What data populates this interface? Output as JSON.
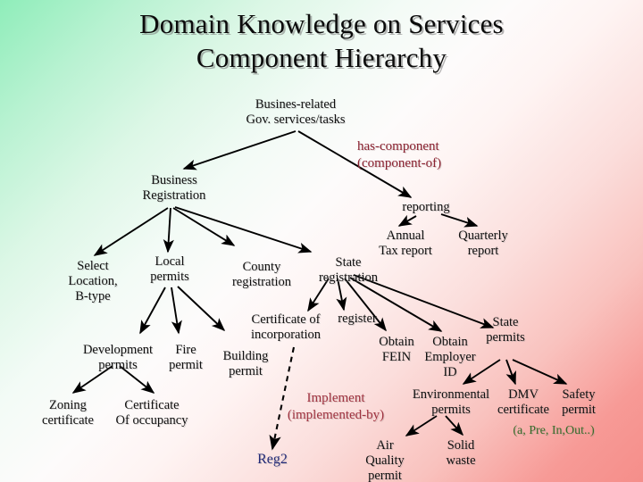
{
  "slide": {
    "title": "Domain Knowledge on Services\nComponent Hierarchy",
    "background": {
      "from": "#8FEDBA",
      "mid": "#FDFBFB",
      "to": "#F58E8A"
    }
  },
  "legends": [
    {
      "key": "has_component",
      "text": "has-component\n(component-of)",
      "color": "#8B2231",
      "meaning": "solid-arrow-relation"
    },
    {
      "key": "implement",
      "text": "Implement\n(implemented-by)",
      "color": "#A03340",
      "meaning": "dashed-arrow-relation"
    }
  ],
  "nodes": {
    "root": "Busines-related\nGov. services/tasks",
    "business_registration": "Business\nRegistration",
    "reporting": "reporting",
    "annual_tax_report": "Annual\nTax report",
    "quarterly_report": "Quarterly\nreport",
    "select_location": "Select\nLocation,\nB-type",
    "local_permits": "Local\npermits",
    "county_registration": "County\nregistration",
    "state_registration": "State\nregistration",
    "development_permits": "Development\npermits",
    "fire_permit": "Fire\npermit",
    "building_permit": "Building\npermit",
    "zoning_certificate": "Zoning\ncertificate",
    "certificate_of_occupancy": "Certificate\nOf occupancy",
    "certificate_of_incorporation": "Certificate of\nincorporation",
    "register": "register",
    "obtain_fein": "Obtain\nFEIN",
    "obtain_employer_id": "Obtain\nEmployer\nID",
    "state_permits": "State\npermits",
    "environmental_permits": "Environmental\npermits",
    "air_quality_permit": "Air\nQuality\npermit",
    "solid_waste": "Solid\nwaste",
    "dmv_certificate": "DMV\ncertificate",
    "safety_permit": "Safety\npermit",
    "green_note": "(a, Pre, In,Out..)",
    "reg2": "Reg2"
  },
  "colors": {
    "node_text": "#111111",
    "has_component": "#8B2231",
    "implement": "#A03340",
    "reg2": "#232A77",
    "green_note": "#3A6B2A",
    "arrow": "#000000"
  },
  "edges": [
    {
      "from": "root",
      "to": "business_registration",
      "style": "solid"
    },
    {
      "from": "root",
      "to": "reporting",
      "style": "solid"
    },
    {
      "from": "reporting",
      "to": "annual_tax_report",
      "style": "solid"
    },
    {
      "from": "reporting",
      "to": "quarterly_report",
      "style": "solid"
    },
    {
      "from": "business_registration",
      "to": "select_location",
      "style": "solid"
    },
    {
      "from": "business_registration",
      "to": "local_permits",
      "style": "solid"
    },
    {
      "from": "business_registration",
      "to": "county_registration",
      "style": "solid"
    },
    {
      "from": "business_registration",
      "to": "state_registration",
      "style": "solid"
    },
    {
      "from": "local_permits",
      "to": "development_permits",
      "style": "solid"
    },
    {
      "from": "local_permits",
      "to": "fire_permit",
      "style": "solid"
    },
    {
      "from": "local_permits",
      "to": "building_permit",
      "style": "solid"
    },
    {
      "from": "development_permits",
      "to": "zoning_certificate",
      "style": "solid"
    },
    {
      "from": "development_permits",
      "to": "certificate_of_occupancy",
      "style": "solid"
    },
    {
      "from": "state_registration",
      "to": "certificate_of_incorporation",
      "style": "solid"
    },
    {
      "from": "state_registration",
      "to": "register",
      "style": "solid"
    },
    {
      "from": "state_registration",
      "to": "obtain_fein",
      "style": "solid"
    },
    {
      "from": "state_registration",
      "to": "obtain_employer_id",
      "style": "solid"
    },
    {
      "from": "state_registration",
      "to": "state_permits",
      "style": "solid"
    },
    {
      "from": "state_permits",
      "to": "environmental_permits",
      "style": "solid"
    },
    {
      "from": "state_permits",
      "to": "dmv_certificate",
      "style": "solid"
    },
    {
      "from": "state_permits",
      "to": "safety_permit",
      "style": "solid"
    },
    {
      "from": "environmental_permits",
      "to": "air_quality_permit",
      "style": "solid"
    },
    {
      "from": "environmental_permits",
      "to": "solid_waste",
      "style": "solid"
    },
    {
      "from": "certificate_of_incorporation",
      "to": "reg2",
      "style": "dashed"
    }
  ]
}
